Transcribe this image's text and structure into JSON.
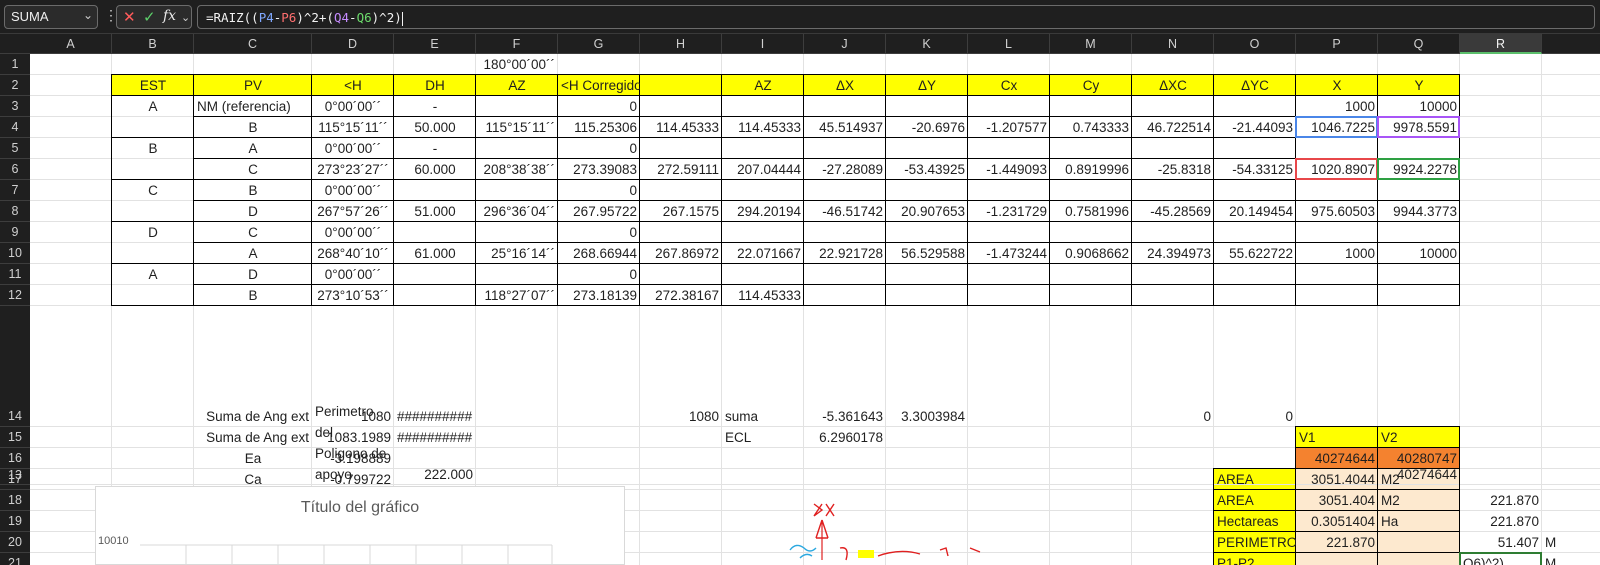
{
  "name_box": "SUMA",
  "formula": {
    "prefix": "=RAIZ((",
    "ref1": "P4",
    "op1": "-",
    "ref2": "P6",
    "mid": ")^2+(",
    "ref3": "Q4",
    "op2": "-",
    "ref4": "Q6",
    "suffix": ")^2)"
  },
  "columns": [
    "A",
    "B",
    "C",
    "D",
    "E",
    "F",
    "G",
    "H",
    "I",
    "J",
    "K",
    "L",
    "M",
    "N",
    "O",
    "P",
    "Q",
    "R"
  ],
  "selected_column": "R",
  "rows": [
    "1",
    "2",
    "3",
    "4",
    "5",
    "6",
    "7",
    "8",
    "9",
    "10",
    "11",
    "12",
    "13",
    "14",
    "15",
    "16",
    "17",
    "18",
    "19",
    "20",
    "21"
  ],
  "cells": {
    "F1": "180°00´00´´",
    "B2": "EST",
    "C2": "PV",
    "D2": "<H",
    "E2": "DH",
    "F2": "AZ",
    "G2": "<H Corregido",
    "I2": "AZ",
    "J2": "ΔX",
    "K2": "ΔY",
    "L2": "Cx",
    "M2": "Cy",
    "N2": "ΔXC",
    "O2": "ΔYC",
    "P2": "X",
    "Q2": "Y",
    "B3": "A",
    "C3": "NM (referencia)",
    "D3": "0°00´00´´",
    "E3": "-",
    "G3": "0",
    "P3": "1000",
    "Q3": "10000",
    "C4": "B",
    "D4": "115°15´11´´",
    "E4": "50.000",
    "F4": "115°15´11´´",
    "G4": "115.25306",
    "H4": "114.45333",
    "I4": "114.45333",
    "J4": "45.514937",
    "K4": "-20.6976",
    "L4": "-1.207577",
    "M4": "0.743333",
    "N4": "46.722514",
    "O4": "-21.44093",
    "P4": "1046.7225",
    "Q4": "9978.5591",
    "B5": "B",
    "C5": "A",
    "D5": "0°00´00´´",
    "E5": "-",
    "G5": "0",
    "C6": "C",
    "D6": "273°23´27´´",
    "E6": "60.000",
    "F6": "208°38´38´´",
    "G6": "273.39083",
    "H6": "272.59111",
    "I6": "207.04444",
    "J6": "-27.28089",
    "K6": "-53.43925",
    "L6": "-1.449093",
    "M6": "0.8919996",
    "N6": "-25.8318",
    "O6": "-54.33125",
    "P6": "1020.8907",
    "Q6": "9924.2278",
    "B7": "C",
    "C7": "B",
    "D7": "0°00´00´´",
    "G7": "0",
    "C8": "D",
    "D8": "267°57´26´´",
    "E8": "51.000",
    "F8": "296°36´04´´",
    "G8": "267.95722",
    "H8": "267.1575",
    "I8": "294.20194",
    "J8": "-46.51742",
    "K8": "20.907653",
    "L8": "-1.231729",
    "M8": "0.7581996",
    "N8": "-45.28569",
    "O8": "20.149454",
    "P8": "975.60503",
    "Q8": "9944.3773",
    "B9": "D",
    "C9": "C",
    "D9": "0°00´00´´",
    "G9": "0",
    "C10": "A",
    "D10": "268°40´10´´",
    "E10": "61.000",
    "F10": "25°16´14´´",
    "G10": "268.66944",
    "H10": "267.86972",
    "I10": "22.071667",
    "J10": "22.921728",
    "K10": "56.529588",
    "L10": "-1.473244",
    "M10": "0.9068662",
    "N10": "24.394973",
    "O10": "55.622722",
    "P10": "1000",
    "Q10": "10000",
    "B11": "A",
    "C11": "D",
    "D11": "0°00´00´´",
    "G11": "0",
    "C12": "B",
    "D12": "273°10´53´´",
    "F12": "118°27´07´´",
    "G12": "273.18139",
    "H12": "272.38167",
    "I12": "114.45333",
    "D13_lines": [
      "Perimetro",
      "del",
      "Poligono de",
      "apoyo"
    ],
    "E13": "222.000",
    "Q13": "40274644",
    "C14": "Suma de Ang ext",
    "D14": "1080",
    "E14": "##########",
    "H14": "1080",
    "I14": "suma",
    "J14": "-5.361643",
    "K14": "3.3003984",
    "N14": "0",
    "O14": "0",
    "C15": "Suma de Ang ext",
    "D15": "1083.1989",
    "E15": "##########",
    "I15": "ECL",
    "J15": "6.2960178",
    "P15": "V1",
    "Q15": "V2",
    "P16": "40274644",
    "Q16": "40280747",
    "C16": "Ea",
    "D16": "-3.198889",
    "C17": "Ca",
    "D17": "-0.799722",
    "O17": "AREA",
    "P17": "3051.4044",
    "Q17": "M2",
    "O18": "AREA",
    "P18": "3051.404",
    "Q18": "M2",
    "R18": "221.870",
    "O19": "Hectareas",
    "P19": "0.3051404",
    "Q19": "Ha",
    "R19": "221.870",
    "O20": "PERIMETRO",
    "P20": "221.870",
    "R20": "51.407",
    "S20": "M",
    "O21": "P1-P2",
    "R21": "Q6)^2)",
    "S21": "M"
  },
  "chart": {
    "title": "Título del gráfico",
    "y_tick": "10010"
  },
  "colors": {
    "yellow": "#ffff00",
    "orange": "#f4822f",
    "peach": "#fde9cf",
    "select_green": "#5bbf6c"
  }
}
